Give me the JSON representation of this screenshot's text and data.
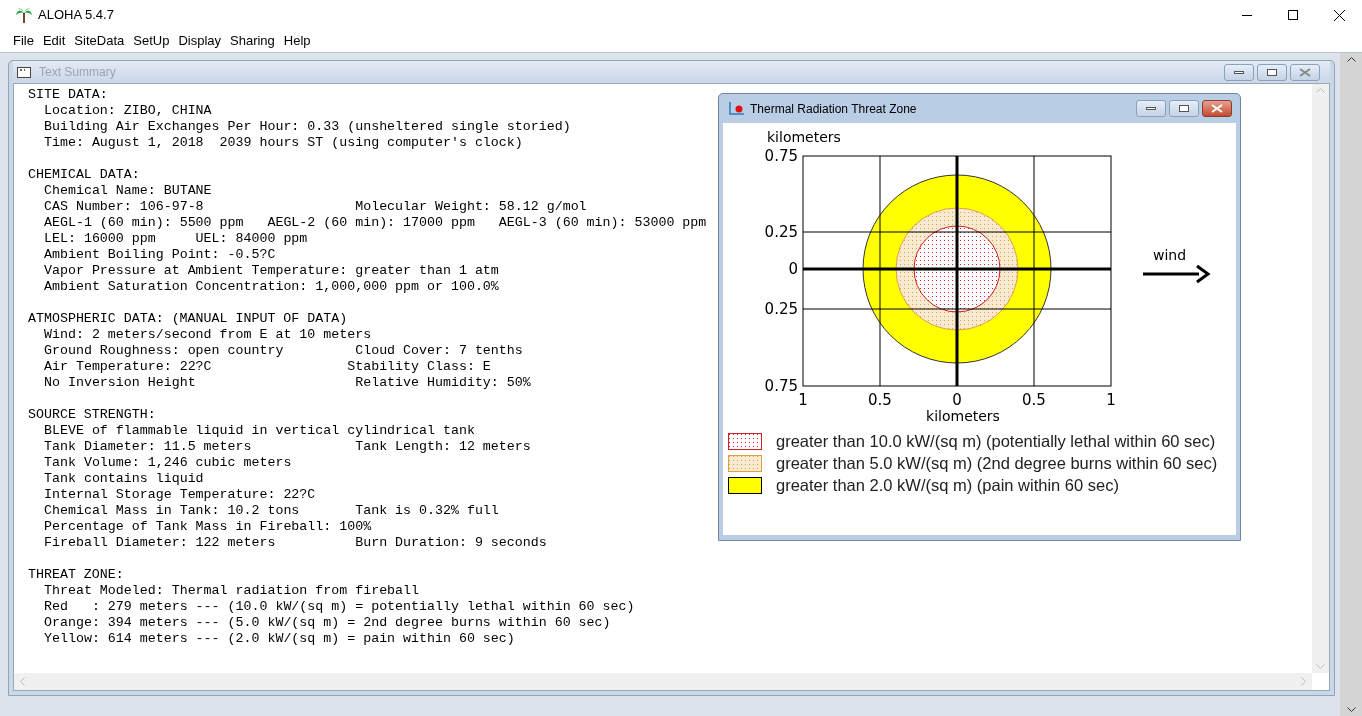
{
  "window": {
    "title": "ALOHA 5.4.7"
  },
  "menu": [
    "File",
    "Edit",
    "SiteData",
    "SetUp",
    "Display",
    "Sharing",
    "Help"
  ],
  "text_summary": {
    "title": "Text Summary",
    "sections": [
      {
        "heading": "SITE DATA:",
        "lines": [
          "Location: ZIBO, CHINA",
          "Building Air Exchanges Per Hour: 0.33 (unsheltered single storied)",
          "Time: August 1, 2018  2039 hours ST (using computer's clock)"
        ]
      },
      {
        "heading": "CHEMICAL DATA:",
        "lines": [
          "Chemical Name: BUTANE",
          "CAS Number: 106-97-8                   Molecular Weight: 58.12 g/mol",
          "AEGL-1 (60 min): 5500 ppm   AEGL-2 (60 min): 17000 ppm   AEGL-3 (60 min): 53000 ppm",
          "LEL: 16000 ppm     UEL: 84000 ppm",
          "Ambient Boiling Point: -0.5?C",
          "Vapor Pressure at Ambient Temperature: greater than 1 atm",
          "Ambient Saturation Concentration: 1,000,000 ppm or 100.0%"
        ]
      },
      {
        "heading": "ATMOSPHERIC DATA: (MANUAL INPUT OF DATA)",
        "lines": [
          "Wind: 2 meters/second from E at 10 meters",
          "Ground Roughness: open country         Cloud Cover: 7 tenths",
          "Air Temperature: 22?C                 Stability Class: E",
          "No Inversion Height                    Relative Humidity: 50%"
        ]
      },
      {
        "heading": "SOURCE STRENGTH:",
        "lines": [
          "BLEVE of flammable liquid in vertical cylindrical tank",
          "Tank Diameter: 11.5 meters             Tank Length: 12 meters",
          "Tank Volume: 1,246 cubic meters",
          "Tank contains liquid",
          "Internal Storage Temperature: 22?C",
          "Chemical Mass in Tank: 10.2 tons       Tank is 0.32% full",
          "Percentage of Tank Mass in Fireball: 100%",
          "Fireball Diameter: 122 meters          Burn Duration: 9 seconds"
        ]
      },
      {
        "heading": "THREAT ZONE:",
        "lines": [
          "Threat Modeled: Thermal radiation from fireball",
          "Red   : 279 meters --- (10.0 kW/(sq m) = potentially lethal within 60 sec)",
          "Orange: 394 meters --- (5.0 kW/(sq m) = 2nd degree burns within 60 sec)",
          "Yellow: 614 meters --- (2.0 kW/(sq m) = pain within 60 sec)"
        ]
      }
    ]
  },
  "threat_zone_window": {
    "title": "Thermal Radiation Threat Zone",
    "y_axis_label": "kilometers",
    "x_axis_label": "kilometers",
    "yticks": [
      "0.75",
      "0.25",
      "0",
      "0.25",
      "0.75"
    ],
    "xticks": [
      "1",
      "0.5",
      "0",
      "0.5",
      "1"
    ],
    "wind_label": "wind",
    "legend": [
      {
        "label": "greater than 10.0 kW/(sq m) (potentially lethal within 60 sec)",
        "kind": "dotted",
        "color": "#d02020"
      },
      {
        "label": "greater than 5.0 kW/(sq m) (2nd degree burns within 60 sec)",
        "kind": "dotted",
        "color": "#e0a040"
      },
      {
        "label": "greater than 2.0 kW/(sq m) (pain within 60 sec)",
        "kind": "solid",
        "color": "#ffff00"
      }
    ]
  }
}
